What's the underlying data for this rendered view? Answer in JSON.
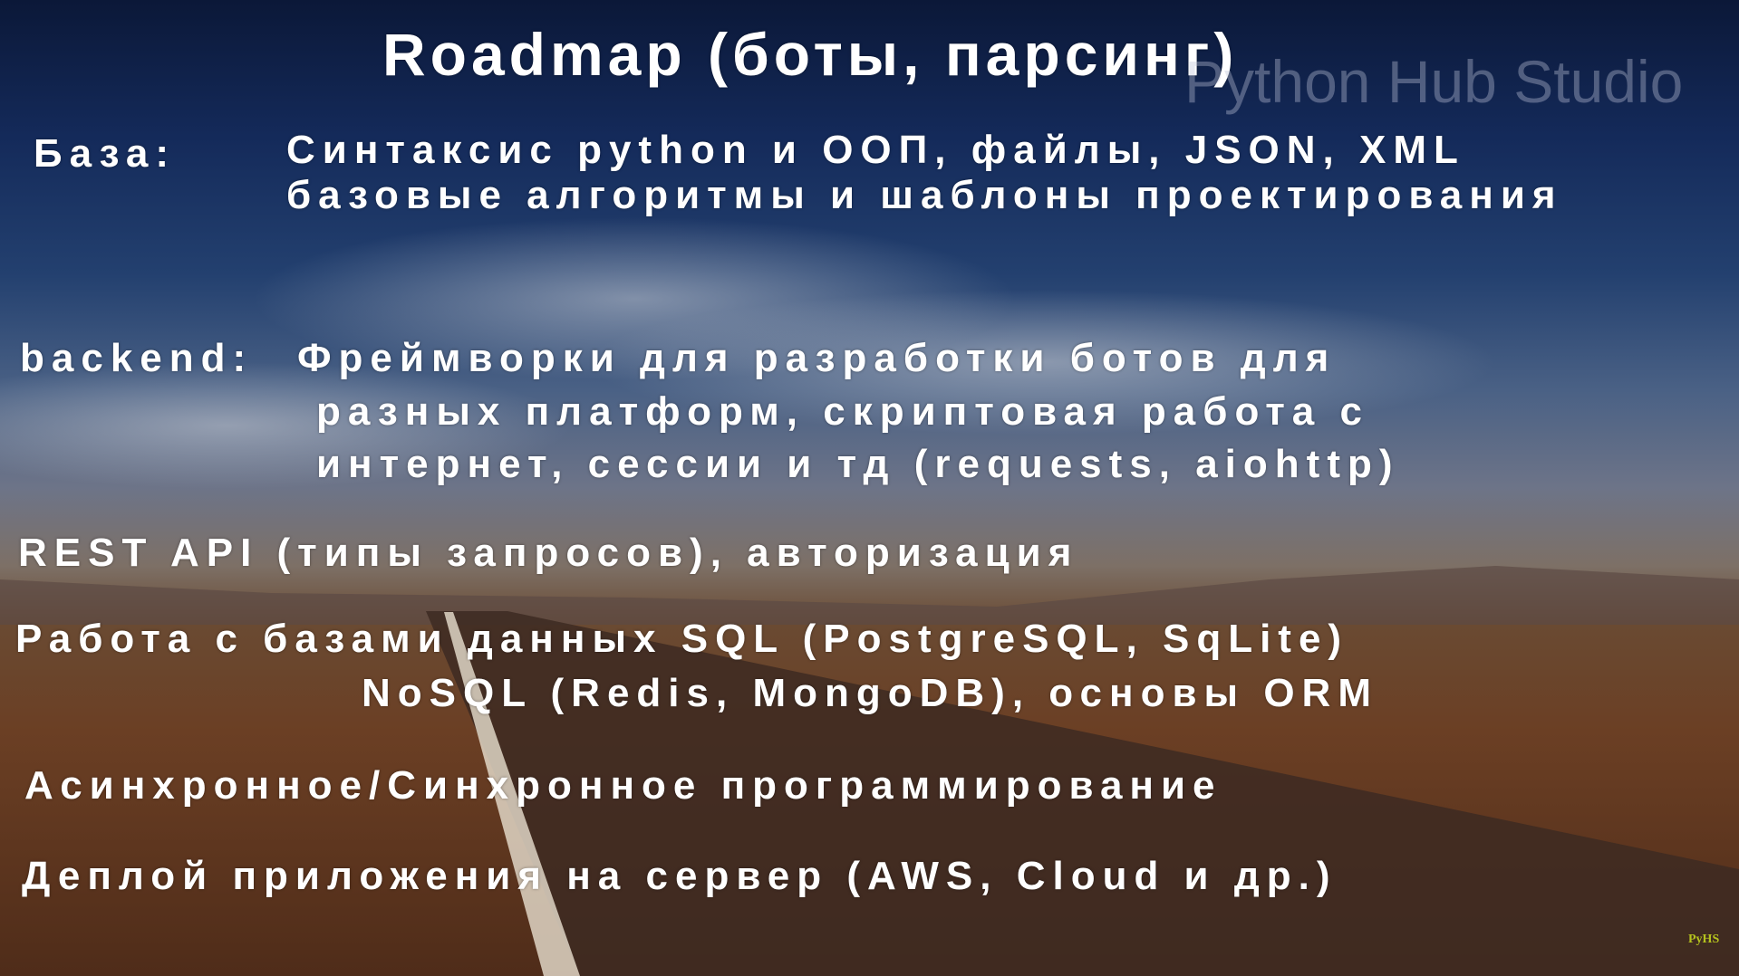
{
  "title": "Roadmap (боты, парсинг)",
  "watermark": "Python Hub Studio",
  "logo": "PyHS",
  "sections": {
    "base": {
      "label": "База:",
      "lines": [
        "Синтаксис python и ООП, файлы, JSON, XML",
        "базовые алгоритмы и шаблоны проектирования"
      ]
    },
    "backend": {
      "label": "backend:",
      "lines": [
        "Фреймворки для разработки ботов для",
        "разных платформ, скриптовая работа с",
        "интернет, сессии и тд (requests, aiohttp)"
      ]
    },
    "rest": "REST API (типы запросов), авторизация",
    "db": {
      "lines": [
        "Работа с базами данных SQL (PostgreSQL, SqLite)",
        "NoSQL (Redis, MongoDB), основы ORM"
      ]
    },
    "async": "Асинхронное/Синхронное программирование",
    "deploy": "Деплой приложения на сервер (AWS, Cloud и др.)"
  }
}
